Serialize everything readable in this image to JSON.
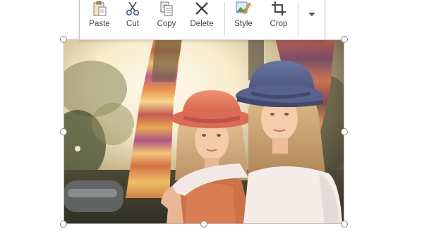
{
  "toolbar": {
    "buttons": [
      {
        "label": "Paste",
        "icon": "paste-icon"
      },
      {
        "label": "Cut",
        "icon": "scissors-icon"
      },
      {
        "label": "Copy",
        "icon": "copy-icon"
      },
      {
        "label": "Delete",
        "icon": "delete-x-icon"
      },
      {
        "label": "Style",
        "icon": "picture-style-icon"
      },
      {
        "label": "Crop",
        "icon": "crop-icon"
      }
    ],
    "more_icon": "chevron-down-icon"
  },
  "picture": {
    "subject": "photo-two-girls-with-hats",
    "colors": {
      "red_hat": "#e0654a",
      "blue_hat": "#4d5a8c",
      "background_glow": "#fff3d6"
    }
  }
}
